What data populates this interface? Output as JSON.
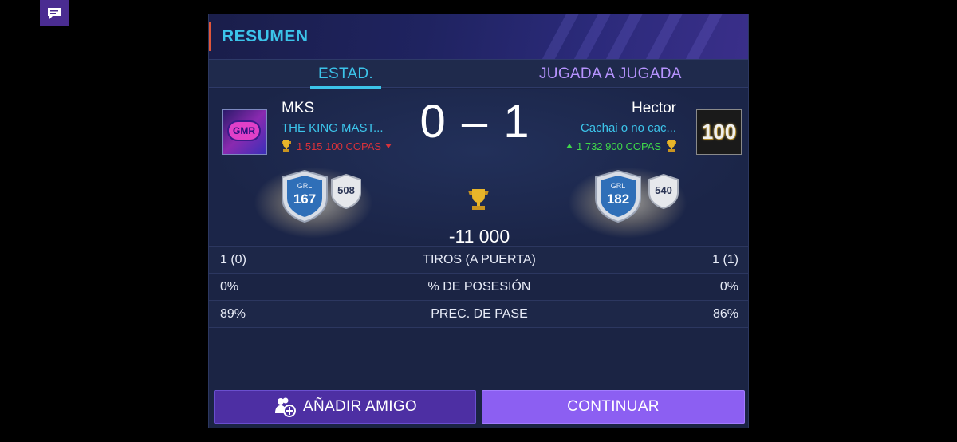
{
  "header": {
    "title": "RESUMEN"
  },
  "tabs": [
    {
      "label": "ESTAD.",
      "active": true
    },
    {
      "label": "JUGADA A JUGADA",
      "active": false
    }
  ],
  "left_player": {
    "name": "MKS",
    "club": "THE KING MAST...",
    "trophies": "1 515 100 COPAS",
    "trophy_trend": "down",
    "avatar_text": "GMR",
    "rating_label": "GRL",
    "rating": "167",
    "secondary_rating": "508"
  },
  "right_player": {
    "name": "Hector",
    "club": "Cachai o no cac...",
    "trophies": "1 732 900 COPAS",
    "trophy_trend": "up",
    "avatar_text": "100",
    "rating_label": "GRL",
    "rating": "182",
    "secondary_rating": "540"
  },
  "score": "0 – 1",
  "trophy_change": "-11 000",
  "stats": [
    {
      "left": "1 (0)",
      "label": "TIROS (A PUERTA)",
      "right": "1 (1)"
    },
    {
      "left": "0%",
      "label": "% DE POSESIÓN",
      "right": "0%"
    },
    {
      "left": "89%",
      "label": "PREC. DE PASE",
      "right": "86%"
    }
  ],
  "buttons": {
    "add_friend": "AÑADIR AMIGO",
    "continue": "CONTINUAR"
  },
  "colors": {
    "accent_cyan": "#3cc4ea",
    "accent_purple": "#8c5ff2",
    "loss_red": "#d9323a",
    "gain_green": "#3fd94a",
    "panel_bg": "#1b2444"
  },
  "icons": {
    "chat": "chat-bubble-icon",
    "trophy": "trophy-icon",
    "add_friend": "add-friend-icon"
  }
}
